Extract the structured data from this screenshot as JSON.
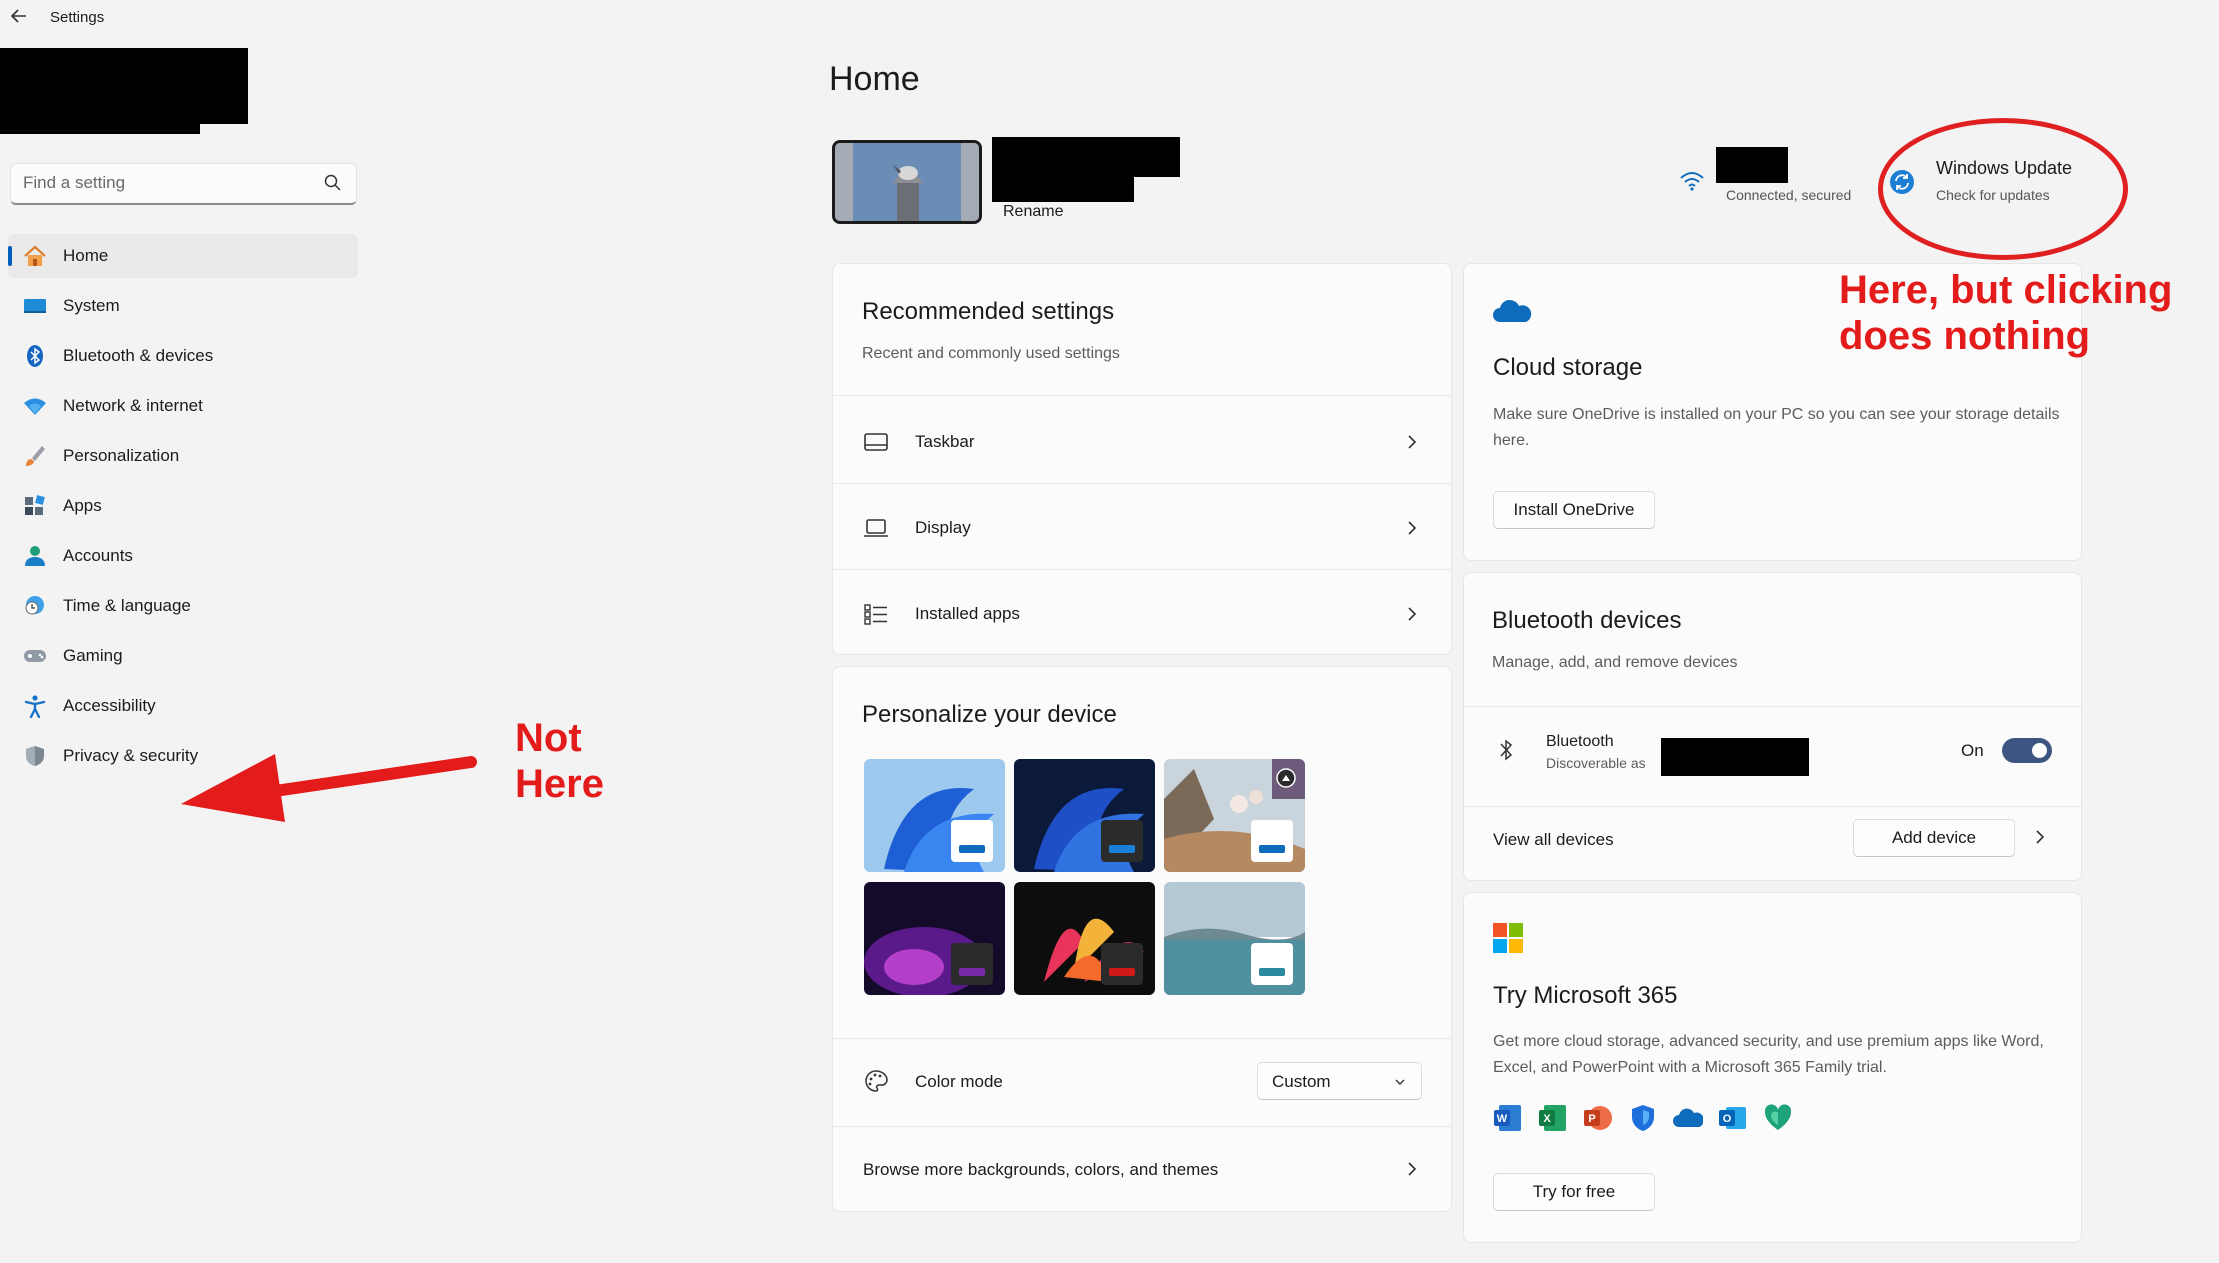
{
  "window": {
    "title": "Settings",
    "back_glyph": "←"
  },
  "search": {
    "placeholder": "Find a setting"
  },
  "nav": {
    "items": [
      {
        "label": "Home",
        "icon": "home-icon",
        "active": true
      },
      {
        "label": "System",
        "icon": "system-icon"
      },
      {
        "label": "Bluetooth & devices",
        "icon": "bluetooth-icon"
      },
      {
        "label": "Network & internet",
        "icon": "wifi-icon"
      },
      {
        "label": "Personalization",
        "icon": "brush-icon"
      },
      {
        "label": "Apps",
        "icon": "apps-icon"
      },
      {
        "label": "Accounts",
        "icon": "person-icon"
      },
      {
        "label": "Time & language",
        "icon": "globe-clock-icon"
      },
      {
        "label": "Gaming",
        "icon": "controller-icon"
      },
      {
        "label": "Accessibility",
        "icon": "accessibility-icon"
      },
      {
        "label": "Privacy & security",
        "icon": "shield-icon"
      }
    ]
  },
  "main": {
    "title": "Home",
    "device": {
      "rename": "Rename"
    },
    "network": {
      "status": "Connected, secured"
    },
    "windows_update": {
      "title": "Windows Update",
      "subtitle": "Check for updates"
    },
    "recommended": {
      "title": "Recommended settings",
      "subtitle": "Recent and commonly used settings",
      "rows": [
        {
          "label": "Taskbar",
          "icon": "taskbar-icon"
        },
        {
          "label": "Display",
          "icon": "laptop-icon"
        },
        {
          "label": "Installed apps",
          "icon": "list-icon"
        }
      ]
    },
    "personalize": {
      "title": "Personalize your device",
      "color_mode": {
        "label": "Color mode",
        "value": "Custom"
      },
      "browse": "Browse more backgrounds, colors, and themes"
    },
    "cloud": {
      "title": "Cloud storage",
      "desc": "Make sure OneDrive is installed on your PC so you can see your storage details here.",
      "button": "Install OneDrive"
    },
    "bluetooth": {
      "title": "Bluetooth devices",
      "subtitle": "Manage, add, and remove devices",
      "device_label": "Bluetooth",
      "device_sub": "Discoverable as",
      "state": "On",
      "view_all": "View all devices",
      "add_button": "Add device"
    },
    "m365": {
      "title": "Try Microsoft 365",
      "desc": "Get more cloud storage, advanced security, and use premium apps like Word, Excel, and PowerPoint with a Microsoft 365 Family trial.",
      "button": "Try for free"
    }
  },
  "annotations": {
    "not_here_line1": "Not",
    "not_here_line2": "Here",
    "here_line1": "Here, but clicking",
    "here_line2": "does nothing"
  },
  "colors": {
    "accent": "#005fb8",
    "annotation": "#e41b1b"
  }
}
